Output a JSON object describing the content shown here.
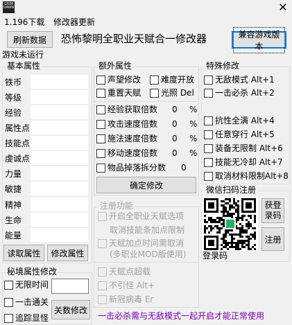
{
  "titlebar": {
    "close": "✕"
  },
  "menu": [
    {
      "label": "1.196下载"
    },
    {
      "label": "修改器更新"
    }
  ],
  "header": {
    "refresh_button": "刷新数据",
    "title": "恐怖黎明全职业天赋合一修改器",
    "compat_button": "兼容游戏版本"
  },
  "status": "游戏未运行",
  "basic": {
    "title": "基本属性",
    "fields": [
      {
        "label": "铁币",
        "value": ""
      },
      {
        "label": "等级",
        "value": ""
      },
      {
        "label": "经验",
        "value": ""
      },
      {
        "label": "属性点",
        "value": ""
      },
      {
        "label": "技能点",
        "value": ""
      },
      {
        "label": "虔诚点",
        "value": ""
      },
      {
        "label": "力量",
        "value": ""
      },
      {
        "label": "敏捷",
        "value": ""
      },
      {
        "label": "精神",
        "value": ""
      },
      {
        "label": "生命",
        "value": ""
      },
      {
        "label": "能量",
        "value": ""
      }
    ],
    "read_button": "读取属性",
    "modify_button": "修改属性"
  },
  "extra": {
    "title": "额外属性",
    "checks": [
      {
        "label": "声望修改"
      },
      {
        "label": "难度开放"
      },
      {
        "label": "重置天赋"
      },
      {
        "label": "光照 Del"
      }
    ],
    "rates": [
      {
        "label": "经验获取倍数",
        "value": "0",
        "unit": "%"
      },
      {
        "label": "攻击速度倍数",
        "value": "0",
        "unit": "%"
      },
      {
        "label": "施法速度倍数",
        "value": "0",
        "unit": "%"
      },
      {
        "label": "移动速度倍数",
        "value": "0",
        "unit": "%"
      },
      {
        "label": "物品掉落拆分数",
        "value": "0",
        "unit": ""
      }
    ],
    "confirm_button": "确定修改"
  },
  "register_features": {
    "title": "注册功能",
    "item1": "开启全职业天赋选项",
    "item1_sub": "取消技能条加点限制",
    "item2": "天赋加点时间需取消",
    "item2_sub": "(多职业MOD版使用)",
    "item3": "天赋点超载",
    "item4": "不引怪 Alt+",
    "item5": "新冠病毒 Er"
  },
  "special": {
    "title": "特殊修改",
    "items": [
      {
        "label": "无敌模式 Alt+1"
      },
      {
        "label": "一击必杀 Alt+2"
      },
      {
        "label": "抗性全满 Alt+4"
      },
      {
        "label": "任意穿行 Alt+5"
      },
      {
        "label": "装备无限制 Alt+6"
      },
      {
        "label": "技能无冷却 Alt+7"
      },
      {
        "label": "取消材料限制Alt+8"
      }
    ]
  },
  "wechat": {
    "title": "微信扫码注册",
    "get_code_line1": "获登",
    "get_code_line2": "录码",
    "register_button": "注册",
    "login_code_label": "登录码"
  },
  "secret": {
    "title": "秘境属性修改",
    "checks": [
      {
        "label": "无限时间"
      },
      {
        "label": "一击通关"
      },
      {
        "label": "追踪显怪"
      }
    ],
    "level_button": "关数修改"
  },
  "footer_tip": "一击必杀需与无敌模式一起开启才能正常使用",
  "colors": {
    "tip": "#7a00a8",
    "focus_border": "#0078d7"
  }
}
